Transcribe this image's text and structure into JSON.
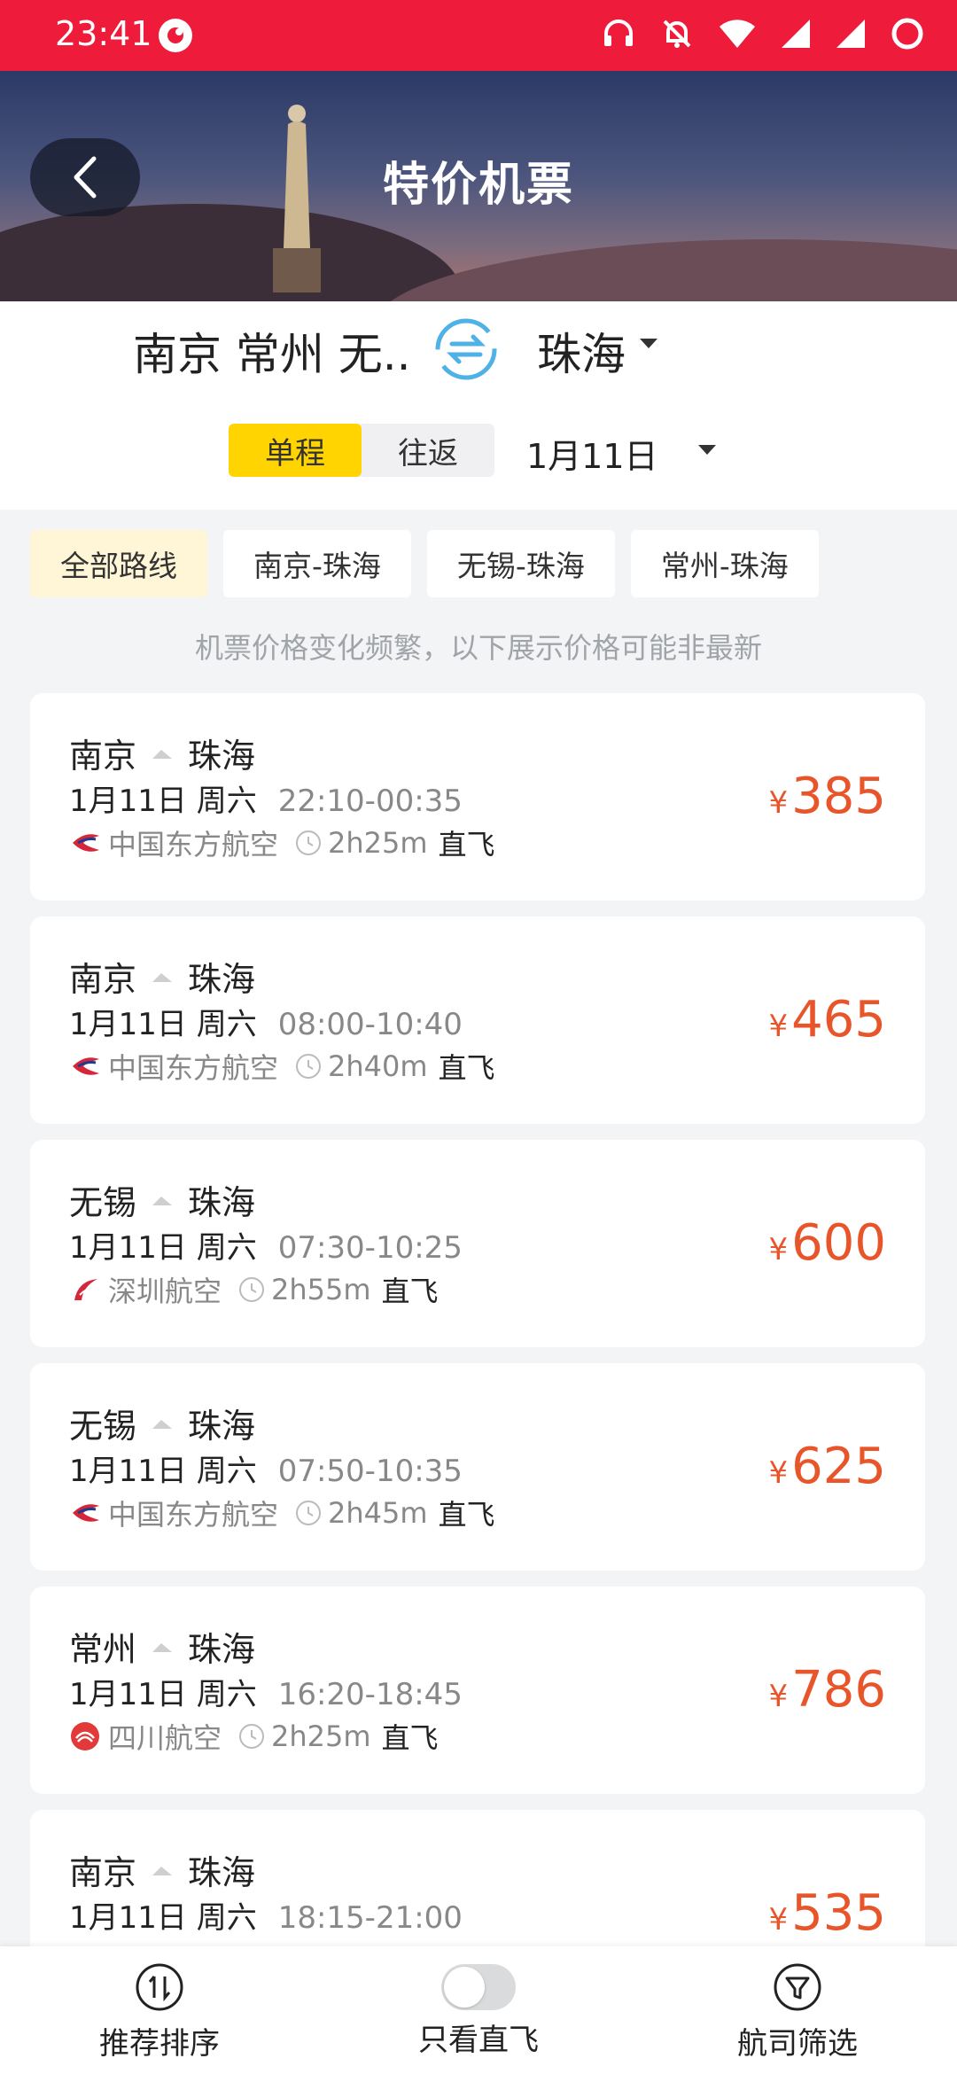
{
  "status": {
    "time": "23:41"
  },
  "header": {
    "title": "特价机票"
  },
  "search": {
    "from": "南京 常州 无..",
    "to": "珠海",
    "trip_types": [
      "单程",
      "往返"
    ],
    "date": "1月11日"
  },
  "routes": [
    "全部路线",
    "南京-珠海",
    "无锡-珠海",
    "常州-珠海"
  ],
  "notice": "机票价格变化频繁，以下展示价格可能非最新",
  "currency": "¥",
  "direct_label": "直飞",
  "flights": [
    {
      "from": "南京",
      "to": "珠海",
      "date": "1月11日 周六",
      "time": "22:10-00:35",
      "airline": "中国东方航空",
      "duration": "2h25m",
      "price": "385",
      "logo": "china-eastern"
    },
    {
      "from": "南京",
      "to": "珠海",
      "date": "1月11日 周六",
      "time": "08:00-10:40",
      "airline": "中国东方航空",
      "duration": "2h40m",
      "price": "465",
      "logo": "china-eastern"
    },
    {
      "from": "无锡",
      "to": "珠海",
      "date": "1月11日 周六",
      "time": "07:30-10:25",
      "airline": "深圳航空",
      "duration": "2h55m",
      "price": "600",
      "logo": "shenzhen"
    },
    {
      "from": "无锡",
      "to": "珠海",
      "date": "1月11日 周六",
      "time": "07:50-10:35",
      "airline": "中国东方航空",
      "duration": "2h45m",
      "price": "625",
      "logo": "china-eastern"
    },
    {
      "from": "常州",
      "to": "珠海",
      "date": "1月11日 周六",
      "time": "16:20-18:45",
      "airline": "四川航空",
      "duration": "2h25m",
      "price": "786",
      "logo": "sichuan"
    },
    {
      "from": "南京",
      "to": "珠海",
      "date": "1月11日 周六",
      "time": "18:15-21:00",
      "airline": "",
      "duration": "",
      "price": "535",
      "logo": ""
    }
  ],
  "bottom_bar": {
    "sort": "推荐排序",
    "direct_only": "只看直飞",
    "airline_filter": "航司筛选"
  },
  "colors": {
    "status_bar": "#ee1c3a",
    "price": "#e8552a",
    "active_tab": "#ffd400"
  }
}
